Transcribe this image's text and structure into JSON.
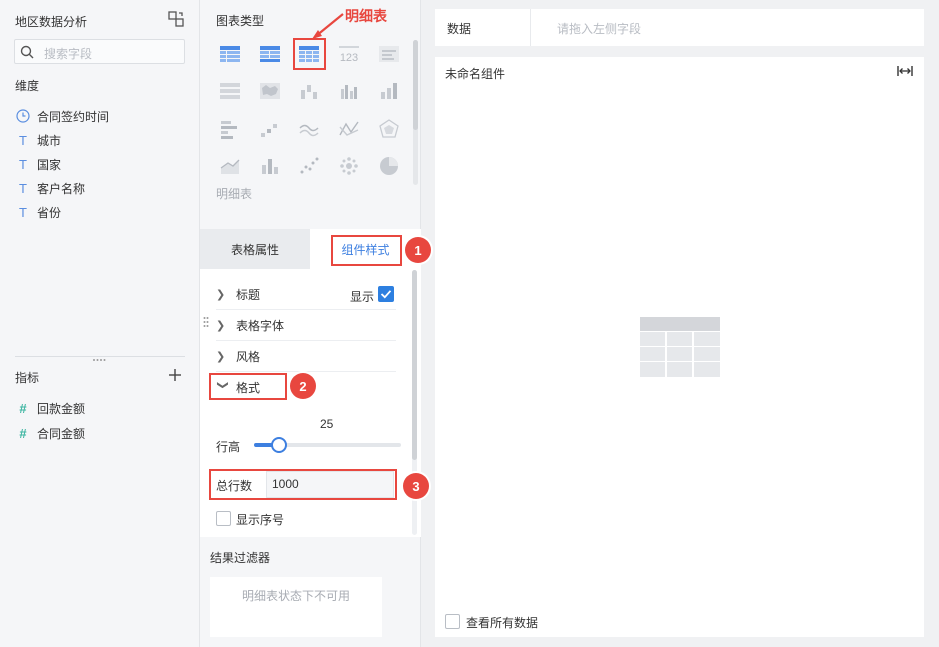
{
  "left": {
    "dataset_title": "地区数据分析",
    "search_placeholder": "搜索字段",
    "dimensions_label": "维度",
    "dimensions": [
      {
        "icon": "clock-icon",
        "label": "合同签约时间"
      },
      {
        "icon": "text-type-icon",
        "label": "城市"
      },
      {
        "icon": "text-type-icon",
        "label": "国家"
      },
      {
        "icon": "text-type-icon",
        "label": "客户名称"
      },
      {
        "icon": "text-type-icon",
        "label": "省份"
      }
    ],
    "measures_label": "指标",
    "measures": [
      {
        "icon": "number-type-icon",
        "label": "回款金额"
      },
      {
        "icon": "number-type-icon",
        "label": "合同金额"
      }
    ]
  },
  "middle": {
    "chart_types_label": "图表类型",
    "selected_chart_name": "明细表",
    "tabs": [
      "表格属性",
      "组件样式"
    ],
    "active_tab": "组件样式",
    "sections": [
      "标题",
      "表格字体",
      "风格",
      "格式"
    ],
    "title_show_label": "显示",
    "row_height_label": "行高",
    "row_height_value": "25",
    "total_rows_label": "总行数",
    "total_rows_value": "1000",
    "show_index_label": "显示序号",
    "result_filter_label": "结果过滤器",
    "filter_unavailable": "明细表状态下不可用"
  },
  "right": {
    "data_label": "数据",
    "data_placeholder": "请拖入左侧字段",
    "component_title": "未命名组件",
    "view_all_label": "查看所有数据"
  },
  "annotations": {
    "callout_text": "明细表",
    "badge1": "1",
    "badge2": "2",
    "badge3": "3",
    "color": "#e8473f"
  },
  "colors": {
    "accent": "#3d7fe0",
    "highlight": "#e8473f"
  }
}
